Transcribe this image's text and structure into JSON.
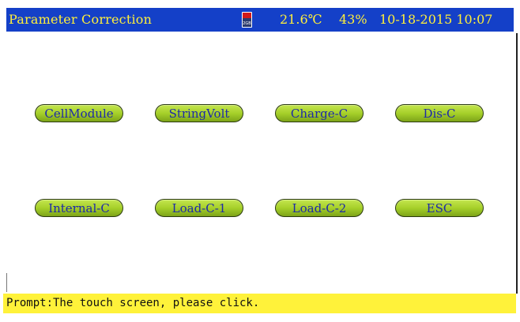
{
  "header": {
    "title": "Parameter Correction",
    "sd_card_text": "2GB",
    "temperature": "21.6℃",
    "humidity": "43%",
    "datetime": "10-18-2015 10:07",
    "colors": {
      "background": "#1440c8",
      "text": "#ffef3a"
    }
  },
  "menu": {
    "buttons": [
      {
        "label": "CellModule"
      },
      {
        "label": "StringVolt"
      },
      {
        "label": "Charge-C"
      },
      {
        "label": "Dis-C"
      },
      {
        "label": "Internal-C"
      },
      {
        "label": "Load-C-1"
      },
      {
        "label": "Load-C-2"
      },
      {
        "label": "ESC"
      }
    ],
    "colors": {
      "button": "#a6d02a",
      "text": "#1e2aa8"
    }
  },
  "prompt": {
    "text": "Prompt:The touch screen, please click.",
    "color": "#fff23a"
  }
}
